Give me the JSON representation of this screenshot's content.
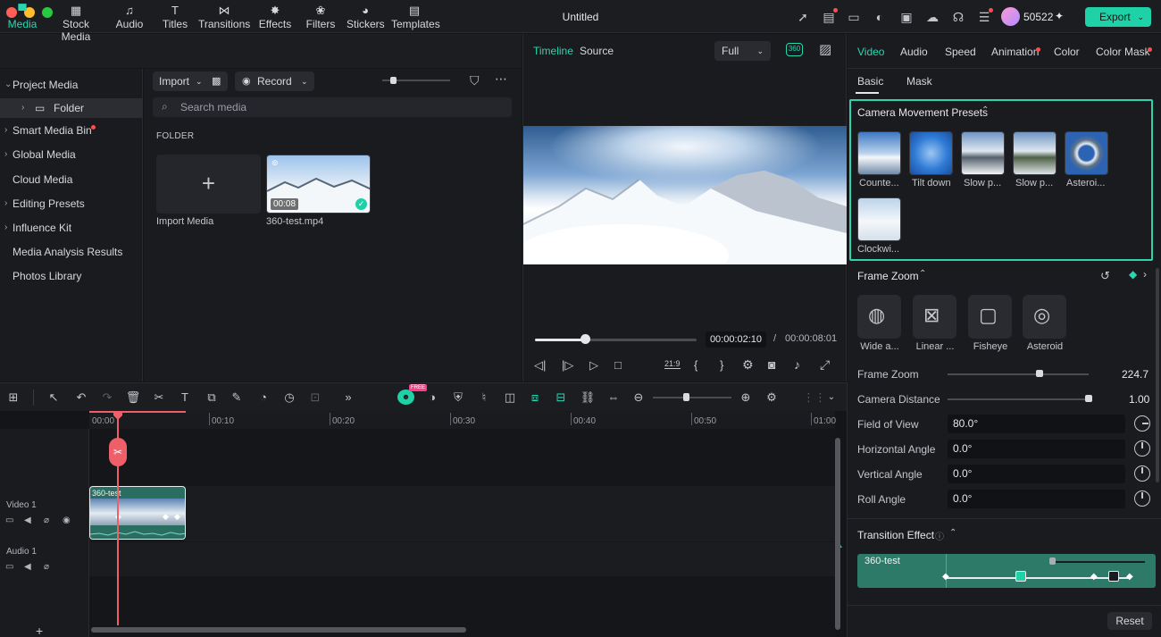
{
  "window": {
    "title": "Untitled",
    "credits": "50522",
    "export_label": "Export"
  },
  "media_tabs": [
    {
      "label": "Media",
      "icon": "media-icon"
    },
    {
      "label": "Stock Media",
      "icon": "stock-media-icon"
    },
    {
      "label": "Audio",
      "icon": "audio-icon"
    },
    {
      "label": "Titles",
      "icon": "titles-icon"
    },
    {
      "label": "Transitions",
      "icon": "transitions-icon"
    },
    {
      "label": "Effects",
      "icon": "effects-icon"
    },
    {
      "label": "Filters",
      "icon": "filters-icon"
    },
    {
      "label": "Stickers",
      "icon": "stickers-icon"
    },
    {
      "label": "Templates",
      "icon": "templates-icon"
    }
  ],
  "tree": {
    "project_media": "Project Media",
    "folder": "Folder",
    "smart_media_bin": "Smart Media Bin",
    "global_media": "Global Media",
    "cloud_media": "Cloud Media",
    "editing_presets": "Editing Presets",
    "influence_kit": "Influence Kit",
    "media_analysis": "Media Analysis Results",
    "photos_library": "Photos Library"
  },
  "media": {
    "import_label": "Import",
    "record_label": "Record",
    "search_placeholder": "Search media",
    "folder_heading": "FOLDER",
    "import_card_label": "Import Media",
    "clip_name": "360-test.mp4",
    "clip_duration": "00:08"
  },
  "preview": {
    "tab_timeline": "Timeline",
    "tab_source": "Source",
    "quality": "Full",
    "current_time": "00:00:02:10",
    "separator": "/",
    "total_time": "00:00:08:01",
    "aspect_badge": "21:9",
    "progress_fraction": 0.31
  },
  "right": {
    "tabs": [
      "Video",
      "Audio",
      "Speed",
      "Animation",
      "Color",
      "Color Mask"
    ],
    "sub_tabs": [
      "Basic",
      "Mask"
    ],
    "presets_title": "Camera Movement Presets",
    "presets": [
      "Counte...",
      "Tilt down",
      "Slow p...",
      "Slow p...",
      "Asteroi...",
      "Clockwi..."
    ],
    "frame_zoom_title": "Frame Zoom",
    "zoom_modes": [
      "Wide a...",
      "Linear ...",
      "Fisheye",
      "Asteroid"
    ],
    "frame_zoom_label": "Frame Zoom",
    "frame_zoom_value": "224.7",
    "frame_zoom_fraction": 0.65,
    "camera_distance_label": "Camera Distance",
    "camera_distance_value": "1.00",
    "camera_distance_fraction": 1.0,
    "fov_label": "Field of View",
    "fov_value": "80.0°",
    "h_angle_label": "Horizontal Angle",
    "h_angle_value": "0.0°",
    "v_angle_label": "Vertical Angle",
    "v_angle_value": "0.0°",
    "roll_label": "Roll Angle",
    "roll_value": "0.0°",
    "transition_title": "Transition Effect",
    "transition_clip": "360-test",
    "reset_label": "Reset"
  },
  "timeline": {
    "ruler": [
      "00:00",
      "00:10",
      "00:20",
      "00:30",
      "00:40",
      "00:50",
      "01:00"
    ],
    "video_track": "Video 1",
    "audio_track": "Audio 1",
    "clip_label": "360-test",
    "free_badge": "FREE"
  },
  "colors": {
    "accent": "#28d7b0",
    "playhead": "#ef5f6a",
    "export": "#1fd1a6"
  }
}
